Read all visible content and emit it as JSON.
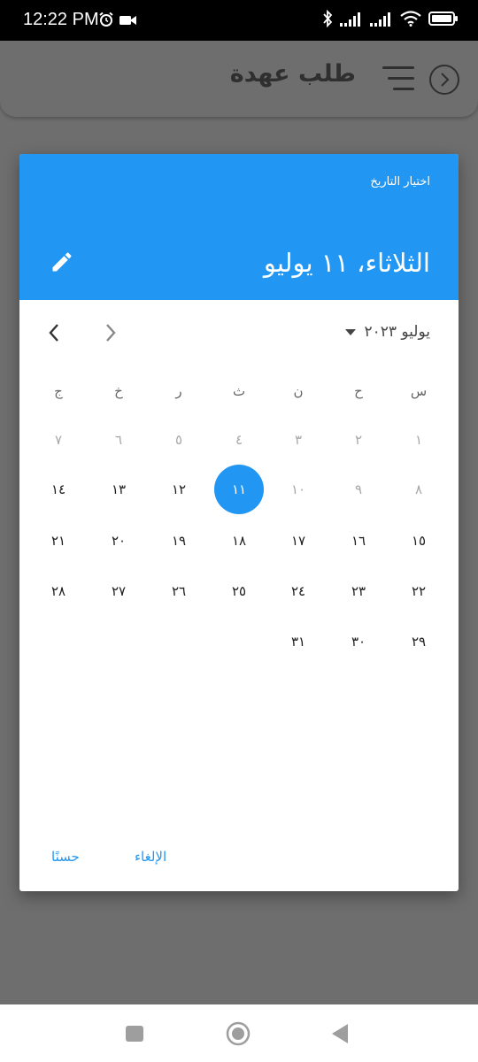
{
  "status": {
    "time": "12:22 PM",
    "left_icons": [
      "alarm-icon",
      "video-camera-icon"
    ],
    "right_icons": [
      "bluetooth-icon",
      "signal-icon",
      "signal-icon",
      "wifi-icon",
      "battery-icon"
    ]
  },
  "header": {
    "title": "طلب عهدة",
    "icons": [
      "menu-icon",
      "back-icon"
    ]
  },
  "dialog": {
    "label": "اختيار التاريخ",
    "selected_date": "الثلاثاء، ١١ يوليو",
    "month_year": "يوليو ٢٠٢٣",
    "weekdays": [
      "س",
      "ح",
      "ن",
      "ث",
      "ر",
      "خ",
      "ج"
    ],
    "weeks": [
      [
        "١",
        "٢",
        "٣",
        "٤",
        "٥",
        "٦",
        "٧"
      ],
      [
        "٨",
        "٩",
        "١٠",
        "١١",
        "١٢",
        "١٣",
        "١٤"
      ],
      [
        "١٥",
        "١٦",
        "١٧",
        "١٨",
        "١٩",
        "٢٠",
        "٢١"
      ],
      [
        "٢٢",
        "٢٣",
        "٢٤",
        "٢٥",
        "٢٦",
        "٢٧",
        "٢٨"
      ],
      [
        "٢٩",
        "٣٠",
        "٣١",
        "",
        "",
        "",
        ""
      ]
    ],
    "disabled_days": [
      "١",
      "٢",
      "٣",
      "٤",
      "٥",
      "٦",
      "٧",
      "٨",
      "٩",
      "١٠"
    ],
    "selected_day": "١١",
    "cancel_label": "الإلغاء",
    "ok_label": "حسنًا",
    "accent_color": "#2196F3"
  },
  "nav": {
    "icons": [
      "recent-apps-icon",
      "home-icon",
      "back-icon"
    ]
  }
}
